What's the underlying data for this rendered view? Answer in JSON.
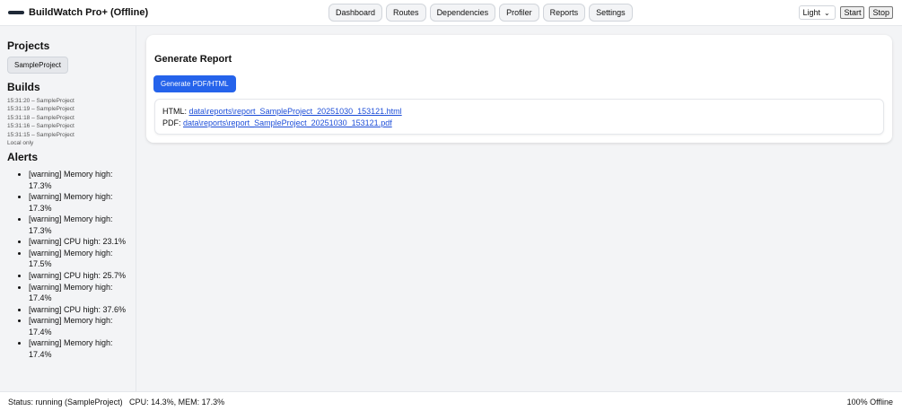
{
  "app": {
    "title": "BuildWatch Pro+ (Offline)"
  },
  "nav": [
    "Dashboard",
    "Routes",
    "Dependencies",
    "Profiler",
    "Reports",
    "Settings"
  ],
  "controls": {
    "theme": "Light",
    "start_label": "Start",
    "stop_label": "Stop"
  },
  "sidebar": {
    "projects_heading": "Projects",
    "project": "SampleProject",
    "builds_heading": "Builds",
    "builds": [
      "15:31:20 – SampleProject",
      "15:31:19 – SampleProject",
      "15:31:18 – SampleProject",
      "15:31:16 – SampleProject",
      "15:31:15 – SampleProject",
      "Local only"
    ],
    "alerts_heading": "Alerts",
    "alerts": [
      "[warning] Memory high: 17.3%",
      "[warning] Memory high: 17.3%",
      "[warning] Memory high: 17.3%",
      "[warning] CPU high: 23.1%",
      "[warning] Memory high: 17.5%",
      "[warning] CPU high: 25.7%",
      "[warning] Memory high: 17.4%",
      "[warning] CPU high: 37.6%",
      "[warning] Memory high: 17.4%",
      "[warning] Memory high: 17.4%"
    ]
  },
  "report": {
    "title": "Generate Report",
    "button": "Generate PDF/HTML",
    "html_label": "HTML:",
    "html_link": "data\\reports\\report_SampleProject_20251030_153121.html",
    "pdf_label": "PDF:",
    "pdf_link": "data\\reports\\report_SampleProject_20251030_153121.pdf"
  },
  "status": {
    "left": "Status: running (SampleProject)   CPU: 14.3%, MEM: 17.3%",
    "right": "100% Offline"
  },
  "colors": {
    "accent": "#2563eb",
    "link": "#1d4ed8"
  }
}
